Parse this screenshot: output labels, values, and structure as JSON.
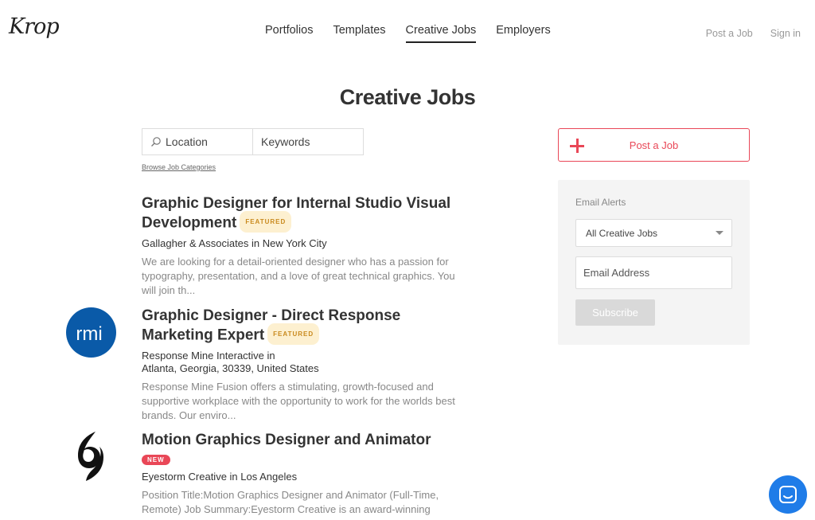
{
  "brand": {
    "logo": "Krop"
  },
  "nav": {
    "items": [
      {
        "label": "Portfolios"
      },
      {
        "label": "Templates"
      },
      {
        "label": "Creative Jobs"
      },
      {
        "label": "Employers"
      }
    ],
    "post_job": "Post a Job",
    "sign_in": "Sign in"
  },
  "page": {
    "title": "Creative Jobs"
  },
  "search": {
    "location_placeholder": "Location",
    "keywords_placeholder": "Keywords",
    "browse_link": "Browse Job Categories"
  },
  "jobs": [
    {
      "title": "Graphic Designer for Internal Studio Visual Development",
      "badge": "FEATURED",
      "company_line1": "Gallagher & Associates in New York City",
      "company_line2": "",
      "description": "We are looking for a detail-oriented designer who has a passion for typography, presentation, and a love of great technical graphics. You will join th..."
    },
    {
      "title": "Graphic Designer - Direct Response Marketing Expert",
      "badge": "FEATURED",
      "logo_text": "rmi",
      "company_line1": "Response Mine Interactive in",
      "company_line2": "Atlanta, Georgia, 30339, United States",
      "description": "Response Mine Fusion offers a stimulating, growth-focused and supportive workplace with the opportunity to work for the worlds best brands. Our enviro..."
    },
    {
      "title": "Motion Graphics Designer and Animator",
      "badge": "NEW",
      "company_line1": "Eyestorm Creative in Los Angeles",
      "company_line2": "",
      "description": "Position Title:Motion Graphics Designer and Animator (Full-Time, Remote) Job Summary:Eyestorm Creative is an award-winning"
    }
  ],
  "sidebar": {
    "post_button": "Post a Job",
    "alerts_heading": "Email Alerts",
    "category_selected": "All Creative Jobs",
    "email_placeholder": "Email Address",
    "subscribe_label": "Subscribe"
  },
  "colors": {
    "accent_red": "#e94757",
    "featured_bg": "#fdf0d0",
    "featured_text": "#c98a1e",
    "rmi_blue": "#0a5aa8",
    "chat_blue": "#1f7ce8"
  },
  "icons": {
    "search": "search-icon",
    "plus": "plus-icon",
    "dropdown": "chevron-down-icon",
    "chat": "chat-icon"
  }
}
